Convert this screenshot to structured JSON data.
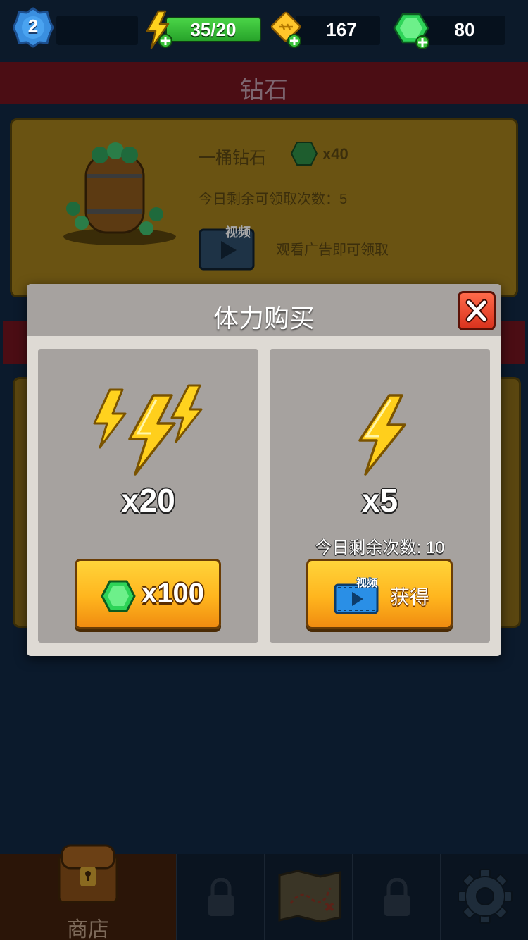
{
  "topbar": {
    "level": "2",
    "energy": "35/20",
    "coins": "167",
    "gems": "80"
  },
  "shop": {
    "section_title": "钻石",
    "offer": {
      "title": "一桶钻石",
      "quantity": "x40",
      "remaining": "今日剩余可领取次数：5",
      "video_tag": "视频",
      "hint": "观看广告即可领取"
    }
  },
  "dialog": {
    "title": "体力购买",
    "left": {
      "amount": "x20",
      "price": "x100"
    },
    "right": {
      "amount": "x5",
      "remaining": "今日剩余次数: 10",
      "video_tag": "视频",
      "button_label": "获得"
    }
  },
  "bottom_nav": {
    "shop_label": "商店"
  },
  "colors": {
    "accent_orange": "#ffb51e",
    "energy_green": "#3cc23c",
    "gem_green": "#29c44a",
    "close_red": "#e3412a"
  }
}
